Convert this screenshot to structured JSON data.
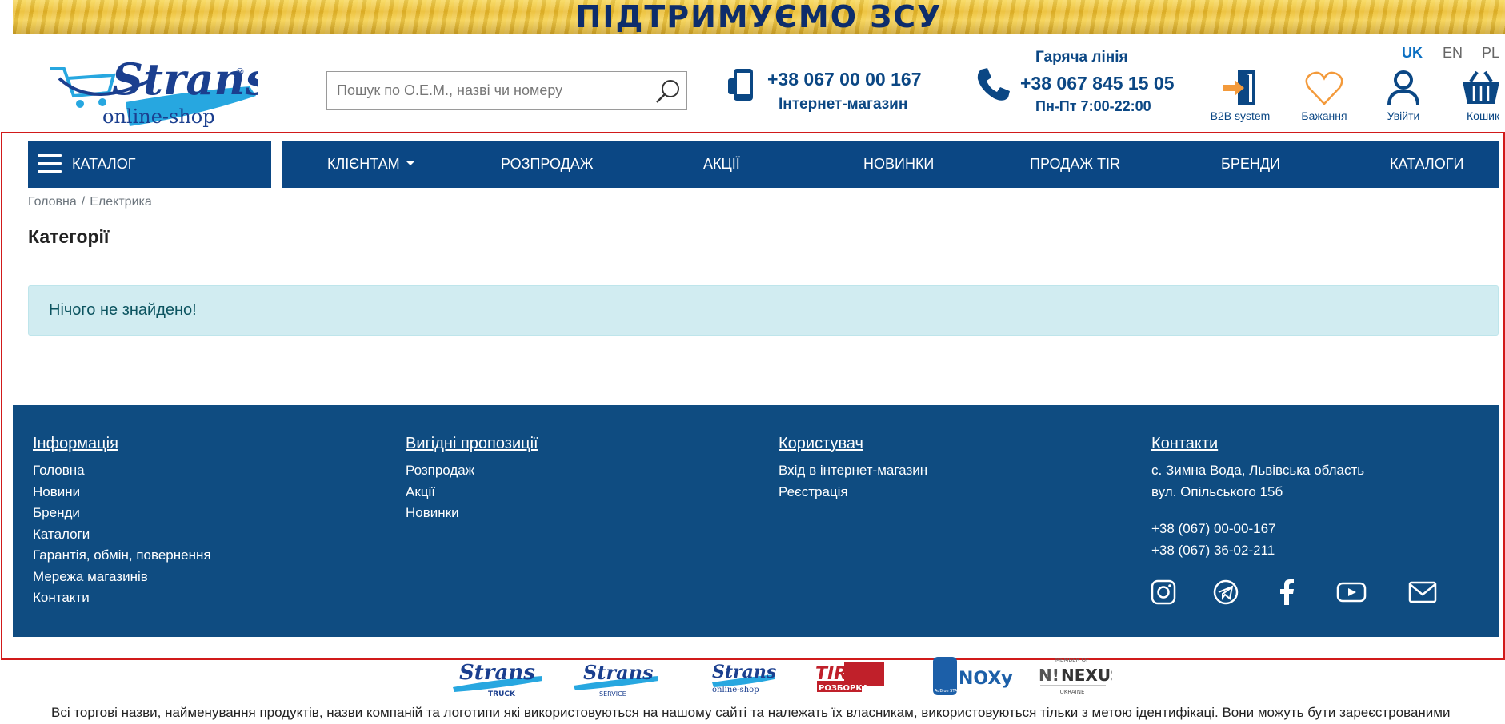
{
  "banner": {
    "text": "ПІДТРИМУЄМО ЗСУ"
  },
  "logo": {
    "brand": "Strans",
    "sub": "online-shop",
    "reg": "®"
  },
  "search": {
    "placeholder": "Пошук по О.Е.М., назві чи номеру"
  },
  "contact_shop": {
    "phone": "+38 067 00 00 167",
    "label": "Інтернет-магазин"
  },
  "hotline": {
    "title": "Гаряча лінія",
    "phone": "+38 067 845 15 05",
    "hours": "Пн-Пт 7:00-22:00"
  },
  "languages": [
    {
      "code": "UK",
      "active": true
    },
    {
      "code": "EN",
      "active": false
    },
    {
      "code": "PL",
      "active": false
    }
  ],
  "header_buttons": {
    "b2b": "B2B system",
    "wishlist": "Бажання",
    "login": "Увійти",
    "cart": "Кошик"
  },
  "nav": {
    "catalog": "КАТАЛОГ",
    "items": [
      "КЛІЄНТАМ",
      "РОЗПРОДАЖ",
      "АКЦІЇ",
      "НОВИНКИ",
      "ПРОДАЖ TIR",
      "БРЕНДИ",
      "КАТАЛОГИ"
    ]
  },
  "breadcrumb": {
    "home": "Головна",
    "sep": "/",
    "current": "Електрика"
  },
  "page": {
    "title": "Категорії",
    "empty_message": "Нічого не знайдено!"
  },
  "footer": {
    "info": {
      "heading": "Інформація",
      "links": [
        "Головна",
        "Новини",
        "Бренди",
        "Каталоги",
        "Гарантія, обмін, повернення",
        "Мережа магазинів",
        "Контакти"
      ]
    },
    "offers": {
      "heading": "Вигідні пропозиції",
      "links": [
        "Розпродаж",
        "Акції",
        "Новинки"
      ]
    },
    "user": {
      "heading": "Користувач",
      "links": [
        "Вхід в інтернет-магазин",
        "Реєстрація"
      ]
    },
    "contacts": {
      "heading": "Контакти",
      "address1": "с. Зимна Вода, Львівська область",
      "address2": "вул. Опільського 15б",
      "phone1": "+38 (067) 00-00-167",
      "phone2": "+38 (067) 36-02-211"
    },
    "social_icons": [
      "instagram-icon",
      "telegram-icon",
      "facebook-icon",
      "youtube-icon",
      "email-icon"
    ]
  },
  "partners": {
    "strans_truck": {
      "name": "Strans",
      "sub": "TRUCK"
    },
    "strans_service": {
      "name": "Strans",
      "sub": "SERVICE"
    },
    "strans_shop": {
      "name": "Strans",
      "sub": "online-shop"
    },
    "tir": {
      "name": "TIR",
      "sub": "РОЗБОРКА"
    },
    "noxy": {
      "name": "NOXy",
      "sub": "AdBlue STATION"
    },
    "nexus": {
      "name": "NEXUS",
      "top": "MEMBER OF",
      "sub": "UKRAINE"
    }
  },
  "disclaimer": "Всі торгові назви, найменування продуктів, назви компаній та логотипи які використовуються на нашому сайті та належать їх власникам, використовуються тільки з метою ідентифікаці. Вони можуть бути зареєстрованими"
}
